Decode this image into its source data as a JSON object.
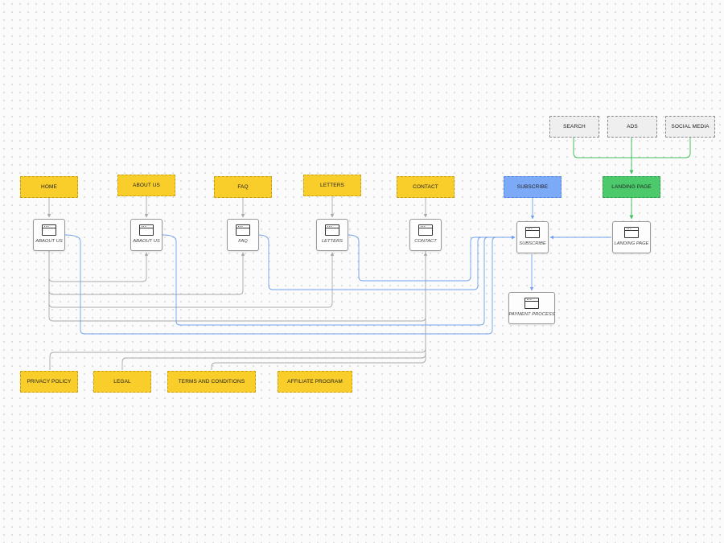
{
  "nav_labels": {
    "home": "HOME",
    "about_us": "ABOUT US",
    "faq": "FAQ",
    "letters": "LETTERS",
    "contact": "CONTACT",
    "subscribe": "SUBSCRIBE",
    "landing_page": "LANDING PAGE"
  },
  "sources": {
    "search": "SEARCH",
    "ads": "ADS",
    "social_media": "SOCIAL MEDIA"
  },
  "pages": {
    "home": "ABAOUT US",
    "about_us": "ABAOUT US",
    "faq": "FAQ",
    "letters": "LETTERS",
    "contact": "CONTACT",
    "subscribe": "SUBSCRIBE",
    "landing_page": "LANDING PAGE",
    "payment": "PAYMENT PROCESS"
  },
  "footer_labels": {
    "privacy": "PRIVACY POLICY",
    "legal": "LEGAL",
    "terms": "TERMS AND CONDITIONS",
    "affiliate": "AFFILIATE PROGRAM"
  },
  "colors": {
    "gray_connector": "#a8a8a8",
    "blue_connector": "#6fa0ee",
    "green_connector": "#45c062",
    "yellow_node": "#f9cd2a",
    "blue_node": "#7daaf7",
    "green_node": "#4bc96b"
  }
}
